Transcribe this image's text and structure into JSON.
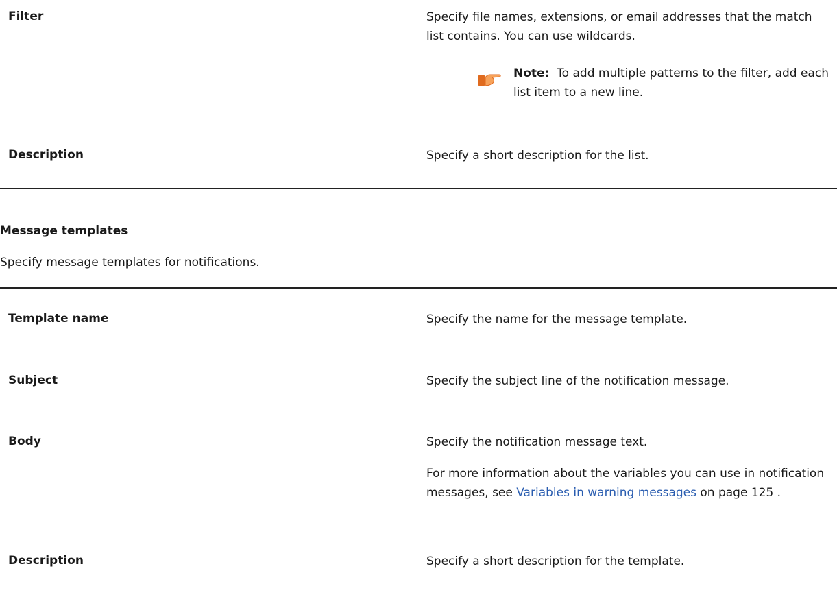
{
  "table1": {
    "rows": [
      {
        "term": "Filter",
        "desc": "Specify file names, extensions, or email addresses that the match list contains. You can use wildcards.",
        "note_label": "Note:",
        "note_text": "To add multiple patterns to the filter, add each list item to a new line."
      },
      {
        "term": "Description",
        "desc": "Specify a short description for the list."
      }
    ]
  },
  "section": {
    "title": "Message templates",
    "intro": "Specify message templates for notifications."
  },
  "table2": {
    "rows": [
      {
        "term": "Template name",
        "desc": "Specify the name for the message template."
      },
      {
        "term": "Subject",
        "desc": "Specify the subject line of the notification message."
      },
      {
        "term": "Body",
        "desc": "Specify the notification message text.",
        "more_prefix": "For more information about the variables you can use in notification messages, see ",
        "link_text": "Variables in warning messages",
        "more_suffix": " on page 125 ."
      },
      {
        "term": "Description",
        "desc": "Specify a short description for the template."
      }
    ]
  },
  "icons": {
    "note": "pointing-hand-icon"
  }
}
